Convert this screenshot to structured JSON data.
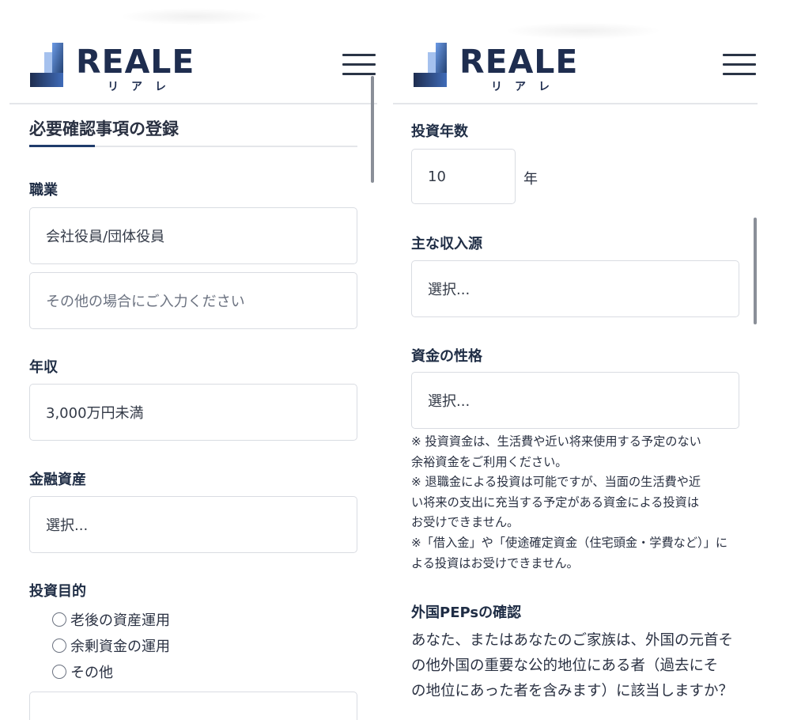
{
  "brand": {
    "name": "REALE",
    "kana": "リアレ",
    "colors": {
      "navy": "#1e2d4f",
      "blue_light": "#5a87d8",
      "blue_dark": "#1f3c6b",
      "border": "#d9dce2"
    }
  },
  "header": {
    "menu_icon": "hamburger-menu-icon"
  },
  "left": {
    "section_title": "必要確認事項の登録",
    "occupation": {
      "label": "職業",
      "value": "会社役員/団体役員",
      "other_placeholder": "その他の場合にご入力ください"
    },
    "annual_income": {
      "label": "年収",
      "value": "3,000万円未満"
    },
    "financial_assets": {
      "label": "金融資産",
      "value": "選択..."
    },
    "investment_purpose": {
      "label": "投資目的",
      "options": [
        "老後の資産運用",
        "余剰資金の運用",
        "その他"
      ]
    }
  },
  "right": {
    "investment_years": {
      "label": "投資年数",
      "value": "10",
      "unit": "年"
    },
    "main_income_source": {
      "label": "主な収入源",
      "value": "選択..."
    },
    "fund_nature": {
      "label": "資金の性格",
      "value": "選択...",
      "notes": [
        "※ 投資資金は、生活費や近い将来使用する予定のない",
        "余裕資金をご利用ください。",
        "※ 退職金による投資は可能ですが、当面の生活費や近",
        "い将来の支出に充当する予定がある資金による投資は",
        "お受けできません。",
        "※「借入金」や「使途確定資金（住宅頭金・学費など）」に",
        "よる投資はお受けできません。"
      ]
    },
    "peps": {
      "title": "外国PEPsの確認",
      "question": [
        "あなた、またはあなたのご家族は、外国の元首そ",
        "の他外国の重要な公的地位にある者（過去にそ",
        "の地位にあった者を含みます）に該当しますか？"
      ]
    }
  }
}
